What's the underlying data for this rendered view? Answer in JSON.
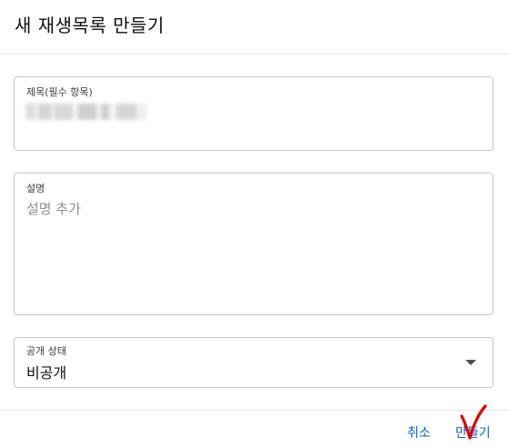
{
  "dialog": {
    "title": "새 재생목록 만들기"
  },
  "title_field": {
    "label": "제목(필수 항목)",
    "value_blurred": true
  },
  "description_field": {
    "label": "설명",
    "placeholder": "설명 추가",
    "value": ""
  },
  "visibility_field": {
    "label": "공개 상태",
    "selected": "비공개"
  },
  "actions": {
    "cancel_label": "취소",
    "create_label": "만들기"
  },
  "annotation": {
    "mark_icon": "red-checkmark-icon",
    "color": "#e00000"
  },
  "colors": {
    "accent": "#065fd4",
    "border": "#c6c6c6"
  }
}
